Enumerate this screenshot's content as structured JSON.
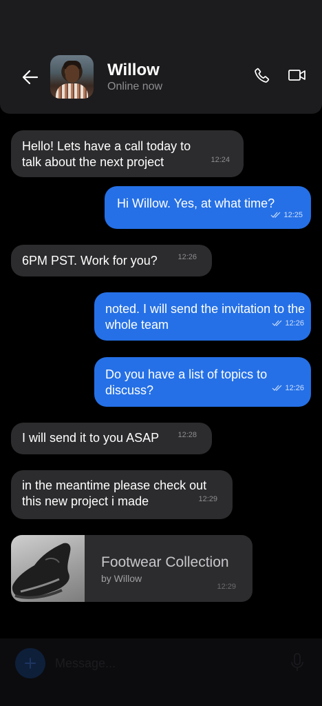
{
  "header": {
    "name": "Willow",
    "status": "Online now"
  },
  "messages": [
    {
      "dir": "in",
      "text": "Hello! Lets have a call today to talk about the next project",
      "time": "12:24"
    },
    {
      "dir": "out",
      "text": "Hi Willow. Yes, at what time?",
      "time": "12:25",
      "read": true
    },
    {
      "dir": "in",
      "text": "6PM PST. Work for you?",
      "time": "12:26"
    },
    {
      "dir": "out",
      "text": "noted. I will send the invitation to the whole team",
      "time": "12:26",
      "read": true
    },
    {
      "dir": "out",
      "text": "Do you have a list of topics to discuss?",
      "time": "12:26",
      "read": true
    },
    {
      "dir": "in",
      "text": "I will send it to you ASAP",
      "time": "12:28"
    },
    {
      "dir": "in",
      "text": "in the meantime please check out this new project i made",
      "time": "12:29"
    }
  ],
  "attachment": {
    "title": "Footwear Collection",
    "byline": "by Willow",
    "time": "12:29",
    "thumb_icon": "sneaker-image"
  },
  "composer": {
    "placeholder": "Message..."
  },
  "colors": {
    "incoming_bubble": "#2c2c2e",
    "outgoing_bubble": "#2570e6",
    "background": "#000000",
    "header": "#1c1c1e"
  }
}
